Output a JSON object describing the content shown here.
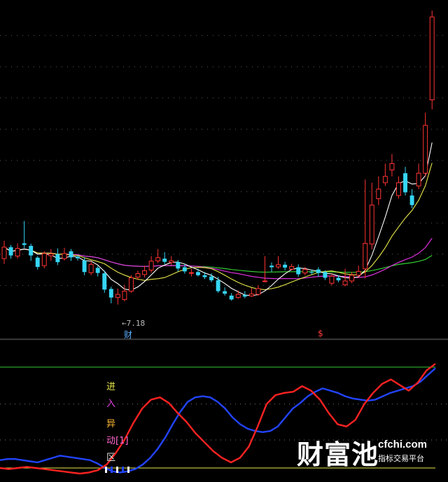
{
  "chart_data": [
    {
      "type": "candlestick",
      "min_price_label": "7.18",
      "marker_cai": "财",
      "marker_s": "$",
      "y_range": [
        6.8,
        16.6
      ],
      "colors": {
        "up": "#ff3333",
        "down": "#35d6f5",
        "ma_white": "#ffffff",
        "ma_yellow": "#e8e84a",
        "ma_magenta": "#e030e0",
        "ma_green": "#33cc33"
      },
      "candles": [
        [
          8.62,
          8.98,
          9.18,
          8.45
        ],
        [
          8.98,
          8.72,
          9.05,
          8.62
        ],
        [
          8.7,
          8.94,
          9.1,
          8.62
        ],
        [
          9.1,
          9.05,
          9.8,
          8.95
        ],
        [
          9.02,
          8.72,
          9.09,
          8.55
        ],
        [
          8.65,
          8.36,
          8.7,
          8.28
        ],
        [
          8.4,
          8.78,
          8.85,
          8.32
        ],
        [
          8.71,
          8.77,
          8.92,
          8.55
        ],
        [
          8.76,
          8.51,
          8.94,
          8.42
        ],
        [
          8.62,
          8.78,
          8.96,
          8.56
        ],
        [
          8.85,
          8.66,
          8.92,
          8.55
        ],
        [
          8.68,
          8.63,
          8.72,
          8.56
        ],
        [
          8.56,
          8.2,
          8.66,
          8.1
        ],
        [
          8.18,
          8.44,
          8.54,
          8.1
        ],
        [
          8.33,
          8.17,
          8.39,
          8.06
        ],
        [
          8.16,
          7.65,
          8.24,
          7.55
        ],
        [
          7.67,
          7.4,
          7.74,
          7.22
        ],
        [
          7.4,
          7.5,
          7.68,
          7.18
        ],
        [
          7.34,
          7.6,
          7.8,
          7.28
        ],
        [
          7.6,
          8.02,
          8.1,
          7.55
        ],
        [
          8.04,
          8.15,
          8.24,
          7.95
        ],
        [
          8.12,
          8.24,
          8.4,
          8.03
        ],
        [
          8.26,
          8.54,
          8.7,
          8.18
        ],
        [
          8.55,
          8.65,
          8.92,
          8.48
        ],
        [
          8.62,
          8.52,
          8.82,
          8.45
        ],
        [
          8.5,
          8.55,
          8.7,
          8.42
        ],
        [
          8.51,
          8.31,
          8.58,
          8.22
        ],
        [
          8.35,
          8.22,
          8.46,
          8.15
        ],
        [
          8.18,
          8.18,
          8.3,
          8.06
        ],
        [
          8.2,
          8.1,
          8.3,
          8.06
        ],
        [
          8.1,
          8.04,
          8.2,
          7.98
        ],
        [
          8.06,
          7.94,
          8.16,
          7.88
        ],
        [
          7.94,
          7.6,
          8.05,
          7.55
        ],
        [
          7.6,
          7.52,
          7.72,
          7.46
        ],
        [
          7.46,
          7.34,
          7.54,
          7.3
        ],
        [
          7.4,
          7.5,
          7.62,
          7.36
        ],
        [
          7.48,
          7.43,
          7.6,
          7.38
        ],
        [
          7.45,
          7.51,
          7.7,
          7.42
        ],
        [
          7.5,
          7.68,
          7.78,
          7.46
        ],
        [
          7.9,
          7.92,
          8.7,
          7.88
        ],
        [
          8.4,
          8.35,
          8.5,
          8.2
        ],
        [
          8.36,
          8.43,
          8.7,
          8.3
        ],
        [
          8.43,
          8.34,
          8.52,
          8.25
        ],
        [
          8.29,
          8.37,
          8.46,
          8.25
        ],
        [
          8.35,
          8.13,
          8.44,
          8.05
        ],
        [
          8.17,
          8.28,
          8.36,
          8.1
        ],
        [
          8.2,
          8.18,
          8.28,
          8.12
        ],
        [
          8.28,
          8.17,
          8.35,
          8.05
        ],
        [
          8.2,
          8.02,
          8.25,
          7.95
        ],
        [
          7.85,
          8.07,
          8.15,
          7.78
        ],
        [
          8.02,
          7.94,
          8.1,
          7.88
        ],
        [
          7.8,
          7.92,
          8.3,
          7.75
        ],
        [
          7.92,
          8.1,
          8.2,
          7.85
        ],
        [
          8.1,
          8.22,
          8.4,
          8.02
        ],
        [
          8.3,
          9.1,
          11.1,
          8.0
        ],
        [
          9.08,
          10.3,
          11.0,
          8.91
        ],
        [
          10.5,
          10.8,
          11.2,
          10.3
        ],
        [
          11.0,
          11.2,
          11.6,
          10.9
        ],
        [
          11.4,
          11.6,
          11.9,
          11.2
        ],
        [
          10.6,
          11.0,
          11.2,
          10.5
        ],
        [
          11.3,
          10.7,
          11.5,
          10.6
        ],
        [
          10.6,
          10.3,
          10.8,
          10.2
        ],
        [
          10.9,
          11.3,
          11.6,
          10.8
        ],
        [
          11.3,
          12.8,
          13.2,
          11.2
        ],
        [
          13.6,
          16.2,
          16.4,
          13.3
        ]
      ]
    },
    {
      "type": "line",
      "labels_vertical": [
        "进",
        "入",
        "异",
        "动[1]",
        "区"
      ],
      "colors": {
        "blue": "#2244ff",
        "red": "#ff2222",
        "upper_line": "#33cc33",
        "lower_line": "#e8e84a",
        "dotted": "#777777",
        "label_yellow": "#e8e84a",
        "label_magenta": "#e040e0",
        "label_orange": "#ffbb33",
        "label_pink": "#ff66cc"
      },
      "y_range": [
        0,
        100
      ],
      "upper_ref": 95,
      "lower_ref": 5,
      "dotted_refs": [
        62,
        30
      ],
      "blue": [
        12,
        13,
        13,
        12,
        11,
        10,
        12,
        14,
        16,
        15,
        14,
        13,
        12,
        9,
        5,
        2,
        1,
        2,
        4,
        8,
        14,
        22,
        32,
        44,
        55,
        64,
        68,
        69,
        68,
        64,
        58,
        50,
        44,
        40,
        38,
        37,
        38,
        42,
        50,
        58,
        63,
        69,
        73,
        76,
        74,
        72,
        69,
        67,
        66,
        65,
        66,
        69,
        72,
        74,
        76,
        78,
        82,
        88,
        94
      ],
      "red": [
        5,
        4,
        5,
        6,
        5,
        4,
        3,
        2,
        1,
        0,
        1,
        3,
        8,
        18,
        30,
        45,
        58,
        66,
        68,
        63,
        54,
        46,
        36,
        28,
        20,
        14,
        10,
        14,
        24,
        42,
        62,
        70,
        72,
        73,
        78,
        74,
        66,
        54,
        44,
        42,
        48,
        62,
        72,
        80,
        84,
        79,
        74,
        81,
        92,
        98
      ]
    }
  ],
  "watermark": {
    "brand": "财富池",
    "domain": "cfchi.com",
    "tagline": "指标交易平台"
  }
}
